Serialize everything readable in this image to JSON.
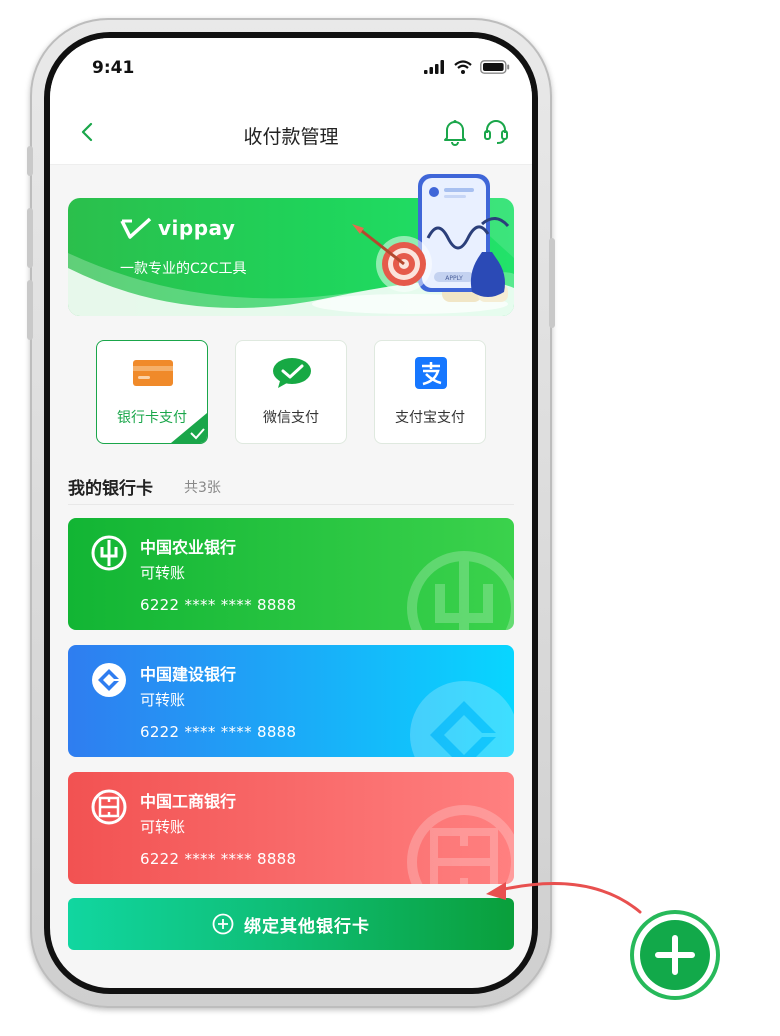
{
  "status": {
    "time": "9:41"
  },
  "nav": {
    "title": "收付款管理"
  },
  "banner": {
    "logo_text": "vippay",
    "subtitle": "一款专业的C2C工具",
    "art_button": "APPLY"
  },
  "pay_methods": [
    {
      "label": "银行卡支付",
      "icon": "bank-card-icon",
      "selected": true
    },
    {
      "label": "微信支付",
      "icon": "wechat-icon",
      "selected": false
    },
    {
      "label": "支付宝支付",
      "icon": "alipay-icon",
      "selected": false
    }
  ],
  "my_cards": {
    "title": "我的银行卡",
    "count": "共3张",
    "cards": [
      {
        "name": "中国农业银行",
        "type": "可转账",
        "number": "6222 **** **** 8888",
        "color": "#1fbe3c"
      },
      {
        "name": "中国建设银行",
        "type": "可转账",
        "number": "6222 **** **** 8888",
        "color": "#2b8cf5"
      },
      {
        "name": "中国工商银行",
        "type": "可转账",
        "number": "6222 **** **** 8888",
        "color": "#f25a5a"
      }
    ]
  },
  "add_button": {
    "label": "绑定其他银行卡"
  },
  "colors": {
    "primary_green": "#1aa64a",
    "fab_green": "#12a94a",
    "arrow_red": "#e8504f"
  }
}
